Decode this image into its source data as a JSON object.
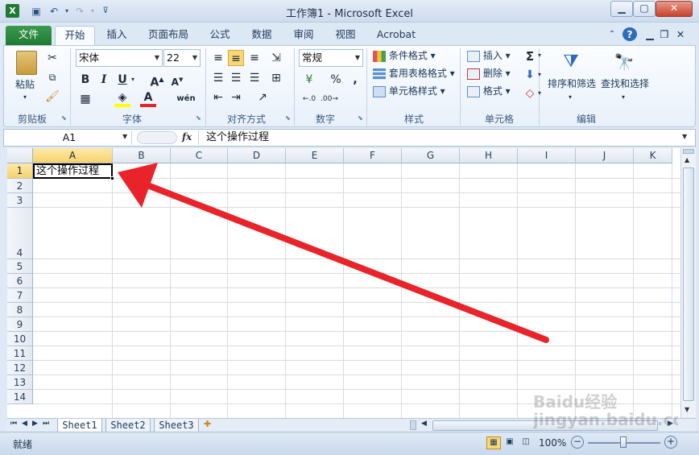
{
  "app": {
    "title": "工作簿1 - Microsoft Excel"
  },
  "tabs": {
    "file": "文件",
    "home": "开始",
    "insert": "插入",
    "layout": "页面布局",
    "formulas": "公式",
    "data": "数据",
    "review": "审阅",
    "view": "视图",
    "acrobat": "Acrobat"
  },
  "ribbon": {
    "paste": "粘贴",
    "font_name": "宋体",
    "font_size": "22",
    "number_format": "常规",
    "cond_format": "条件格式",
    "table_format": "套用表格格式",
    "cell_style": "单元格样式",
    "insert": "插入",
    "delete": "删除",
    "format": "格式",
    "sort_filter": "排序和筛选",
    "find_select": "查找和选择",
    "bold": "B",
    "italic": "I",
    "underline": "U",
    "percent": "%",
    "comma": ",",
    "groups": {
      "clipboard": "剪贴板",
      "font": "字体",
      "alignment": "对齐方式",
      "number": "数字",
      "styles": "样式",
      "cells": "单元格",
      "editing": "编辑"
    }
  },
  "formula_bar": {
    "name_box": "A1",
    "fx": "fx",
    "content": "这个操作过程"
  },
  "grid": {
    "columns": [
      "A",
      "B",
      "C",
      "D",
      "E",
      "F",
      "G",
      "H",
      "I",
      "J",
      "K"
    ],
    "rows": [
      "1",
      "2",
      "3",
      "4",
      "5",
      "6",
      "7",
      "8",
      "9",
      "10",
      "11",
      "12",
      "13",
      "14"
    ],
    "cells": {
      "A1": "这个操作过程"
    },
    "selected": "A1"
  },
  "sheets": [
    "Sheet1",
    "Sheet2",
    "Sheet3"
  ],
  "status": {
    "ready": "就绪",
    "zoom": "100%"
  },
  "watermark": "Baidu经验 jingyan.baidu.com",
  "colors": {
    "file_tab": "#2a8a3e",
    "arrow": "#e8242a",
    "selection_header": "#f6d26d"
  }
}
